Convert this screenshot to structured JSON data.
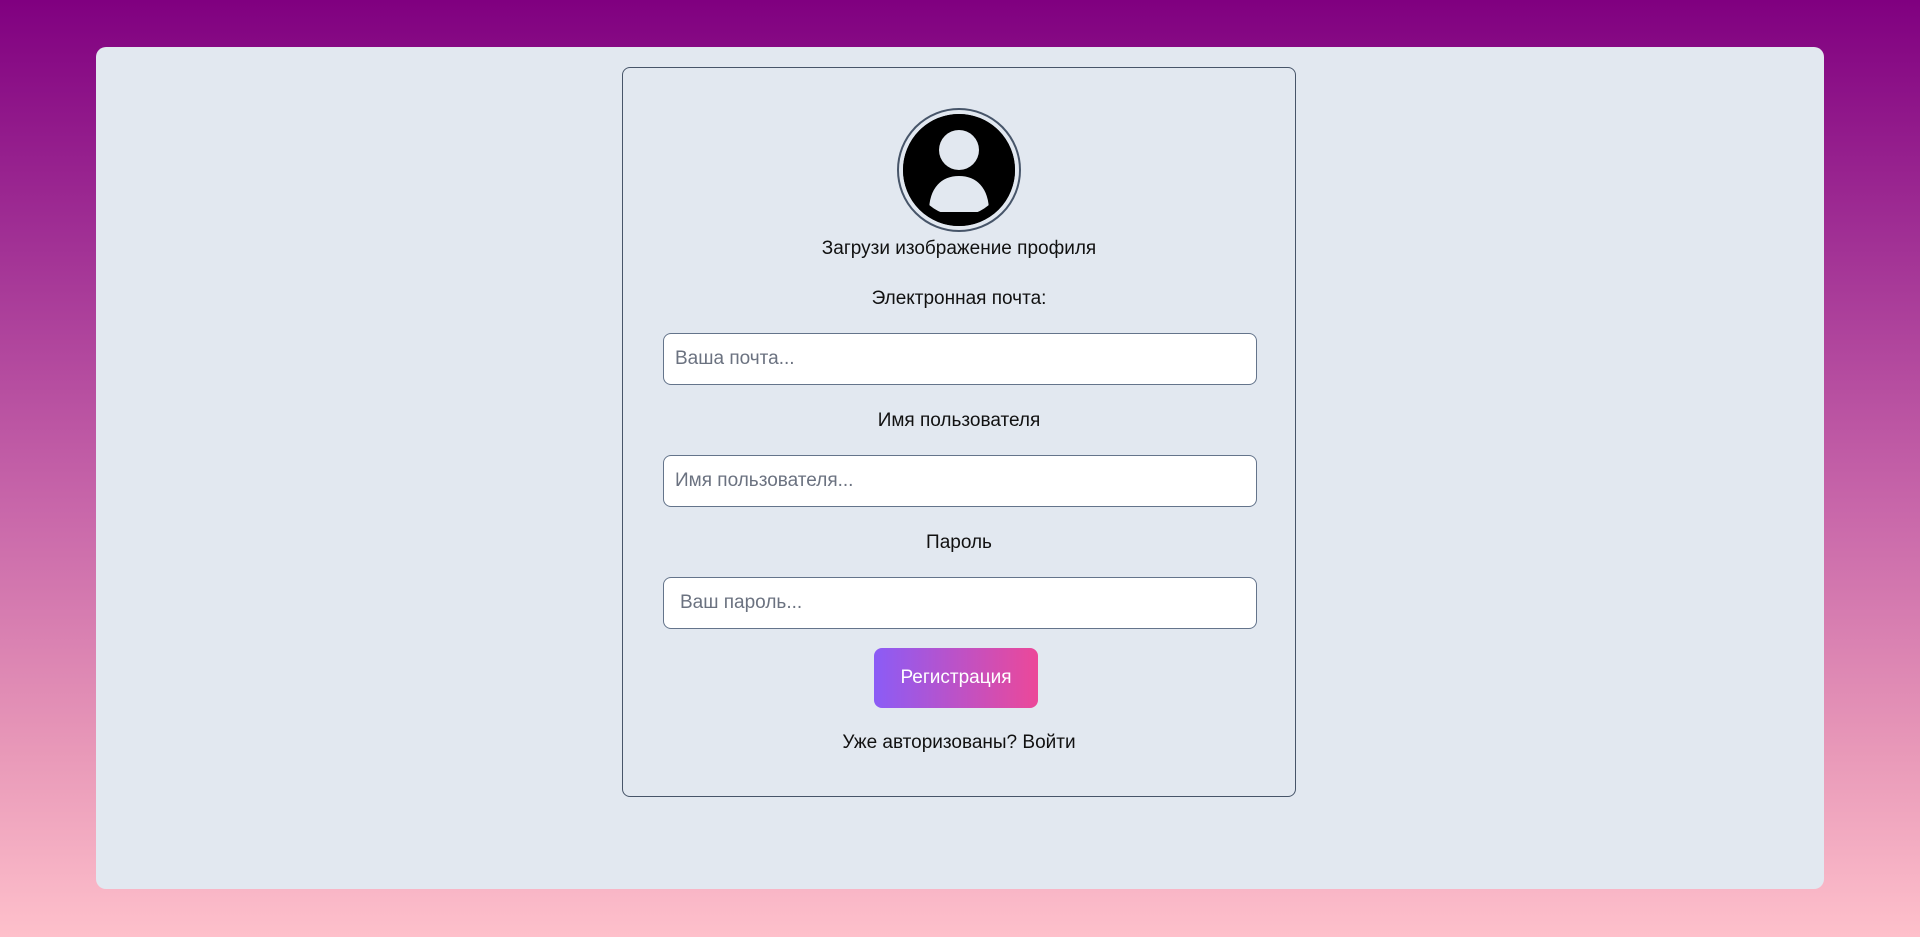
{
  "form": {
    "upload_text": "Загрузи изображение профиля",
    "email": {
      "label": "Электронная почта:",
      "placeholder": "Ваша почта...",
      "value": ""
    },
    "username": {
      "label": "Имя пользователя",
      "placeholder": "Имя пользователя...",
      "value": ""
    },
    "password": {
      "label": "Пароль",
      "placeholder": "Ваш пароль...",
      "value": ""
    },
    "submit_label": "Регистрация",
    "login_prompt": "Уже авторизованы?",
    "login_link": "Войти"
  },
  "icons": {
    "avatar": "user-avatar-icon"
  },
  "colors": {
    "background_top": "#800080",
    "background_bottom": "#fec0cb",
    "panel": "#e2e8f0",
    "button_gradient_start": "#8b5cf6",
    "button_gradient_end": "#ec4899"
  }
}
